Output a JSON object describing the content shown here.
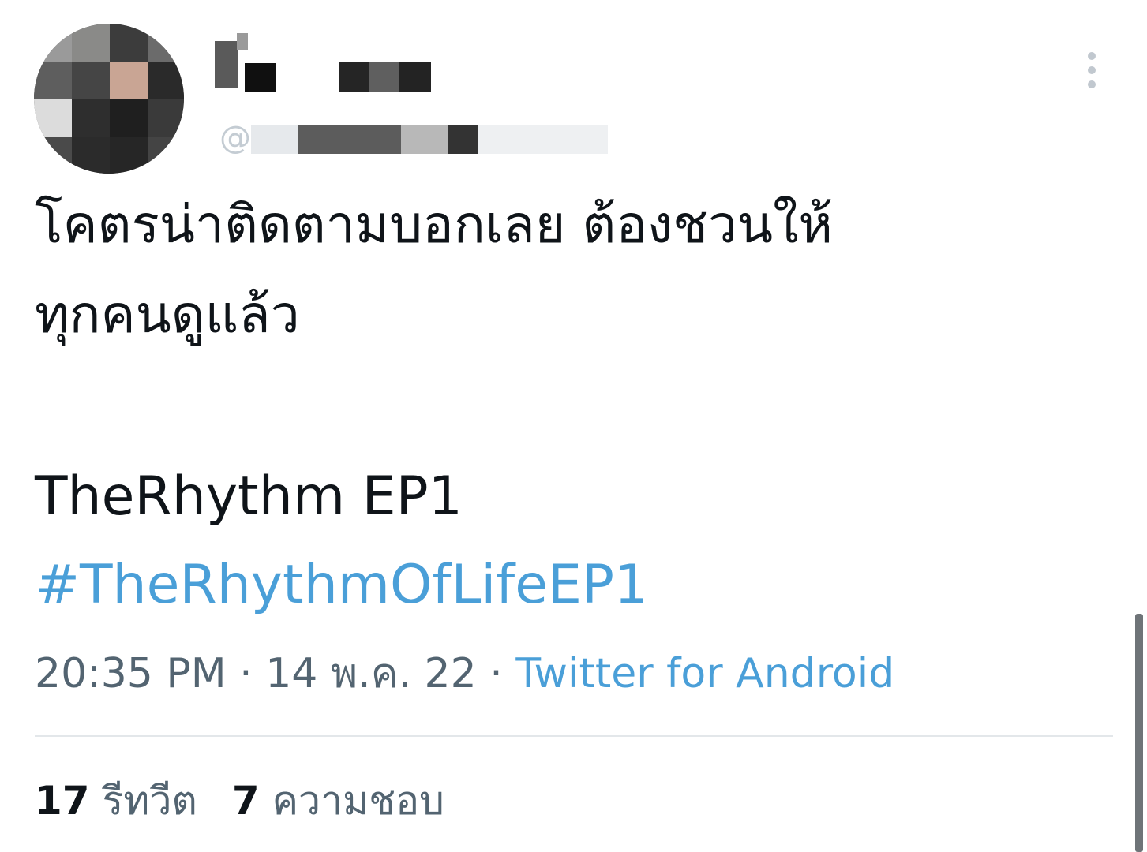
{
  "author": {
    "handle_prefix": "@",
    "avatar_icon": "avatar-blurred",
    "menu_icon": "more-vertical-icon"
  },
  "tweet": {
    "text": "โคตรน่าติดตามบอกเลย ต้องชวนให้\nทุกคนดูแล้ว",
    "title_line": "TheRhythm EP1",
    "hashtag": "#TheRhythmOfLifeEP1"
  },
  "meta": {
    "time": "20:35 PM",
    "separator1": " · ",
    "date": "14 พ.ค. 22",
    "separator2": " · ",
    "source": "Twitter for Android"
  },
  "stats": {
    "retweets_count": "17",
    "retweets_label": "รีทวีต",
    "likes_count": "7",
    "likes_label": "ความชอบ"
  },
  "colors": {
    "link": "#4a9fd8",
    "text": "#0f1419",
    "secondary": "#536471"
  }
}
